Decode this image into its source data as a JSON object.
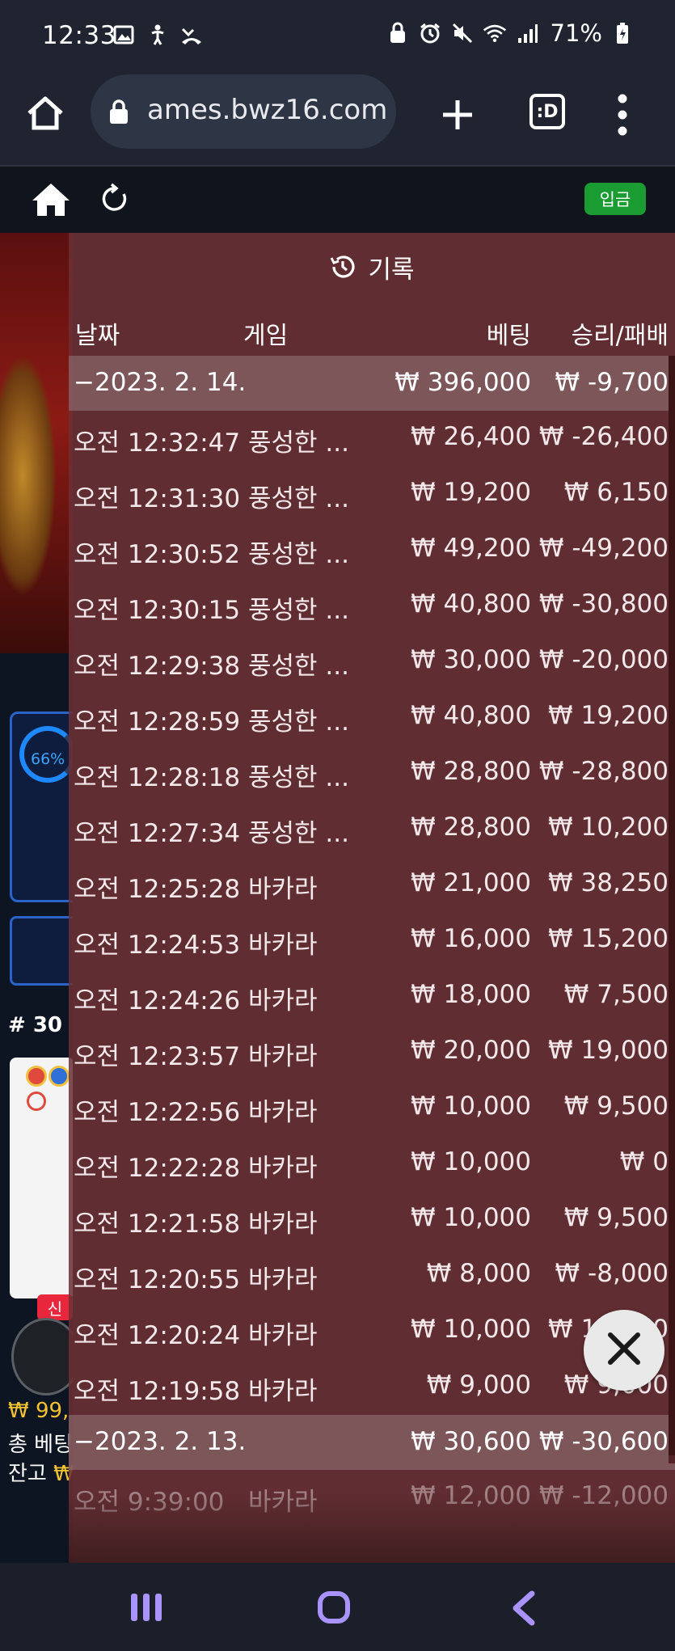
{
  "status_bar": {
    "time": "12:33",
    "battery": "71%",
    "left_icons": [
      "image-icon",
      "accessibility-icon",
      "missed-call-icon"
    ],
    "right_icons": [
      "lock-icon",
      "alarm-icon",
      "mute-icon",
      "wifi-icon",
      "signal-icon",
      "battery-icon"
    ]
  },
  "browser": {
    "url": "ames.bwz16.com",
    "tabs_label": ":D"
  },
  "site_header": {
    "deposit_label": "입금"
  },
  "background_game": {
    "progress_label": "66%",
    "round_label": "# 30",
    "new_badge": "신",
    "balance_line1": "₩ 99,",
    "balance_line2": "총 베팅",
    "balance_line3_prefix": "잔고",
    "balance_line3_value": "₩"
  },
  "history": {
    "title": "기록",
    "columns": {
      "date": "날짜",
      "game": "게임",
      "bet": "베팅",
      "result": "승리/패배"
    },
    "groups": [
      {
        "date": "−2023. 2. 14.",
        "total_bet": "₩ 396,000",
        "total_result": "₩ -9,700",
        "rows": [
          {
            "time": "오전 12:32:47",
            "game": "풍성한 ...",
            "bet": "₩ 26,400",
            "result": "₩ -26,400"
          },
          {
            "time": "오전 12:31:30",
            "game": "풍성한 ...",
            "bet": "₩ 19,200",
            "result": "₩ 6,150"
          },
          {
            "time": "오전 12:30:52",
            "game": "풍성한 ...",
            "bet": "₩ 49,200",
            "result": "₩ -49,200"
          },
          {
            "time": "오전 12:30:15",
            "game": "풍성한 ...",
            "bet": "₩ 40,800",
            "result": "₩ -30,800"
          },
          {
            "time": "오전 12:29:38",
            "game": "풍성한 ...",
            "bet": "₩ 30,000",
            "result": "₩ -20,000"
          },
          {
            "time": "오전 12:28:59",
            "game": "풍성한 ...",
            "bet": "₩ 40,800",
            "result": "₩ 19,200"
          },
          {
            "time": "오전 12:28:18",
            "game": "풍성한 ...",
            "bet": "₩ 28,800",
            "result": "₩ -28,800"
          },
          {
            "time": "오전 12:27:34",
            "game": "풍성한 ...",
            "bet": "₩ 28,800",
            "result": "₩ 10,200"
          },
          {
            "time": "오전 12:25:28",
            "game": "바카라",
            "bet": "₩ 21,000",
            "result": "₩ 38,250"
          },
          {
            "time": "오전 12:24:53",
            "game": "바카라",
            "bet": "₩ 16,000",
            "result": "₩ 15,200"
          },
          {
            "time": "오전 12:24:26",
            "game": "바카라",
            "bet": "₩ 18,000",
            "result": "₩ 7,500"
          },
          {
            "time": "오전 12:23:57",
            "game": "바카라",
            "bet": "₩ 20,000",
            "result": "₩ 19,000"
          },
          {
            "time": "오전 12:22:56",
            "game": "바카라",
            "bet": "₩ 10,000",
            "result": "₩ 9,500"
          },
          {
            "time": "오전 12:22:28",
            "game": "바카라",
            "bet": "₩ 10,000",
            "result": "₩ 0"
          },
          {
            "time": "오전 12:21:58",
            "game": "바카라",
            "bet": "₩ 10,000",
            "result": "₩ 9,500"
          },
          {
            "time": "오전 12:20:55",
            "game": "바카라",
            "bet": "₩ 8,000",
            "result": "₩ -8,000"
          },
          {
            "time": "오전 12:20:24",
            "game": "바카라",
            "bet": "₩ 10,000",
            "result": "₩ 10,000"
          },
          {
            "time": "오전 12:19:58",
            "game": "바카라",
            "bet": "₩ 9,000",
            "result": "₩ 9,000"
          }
        ]
      },
      {
        "date": "−2023. 2. 13.",
        "total_bet": "₩ 30,600",
        "total_result": "₩ -30,600",
        "rows": [
          {
            "time": "오전 9:39:00",
            "game": "바카라",
            "bet": "₩ 12,000",
            "result": "₩ -12,000"
          }
        ]
      }
    ]
  }
}
